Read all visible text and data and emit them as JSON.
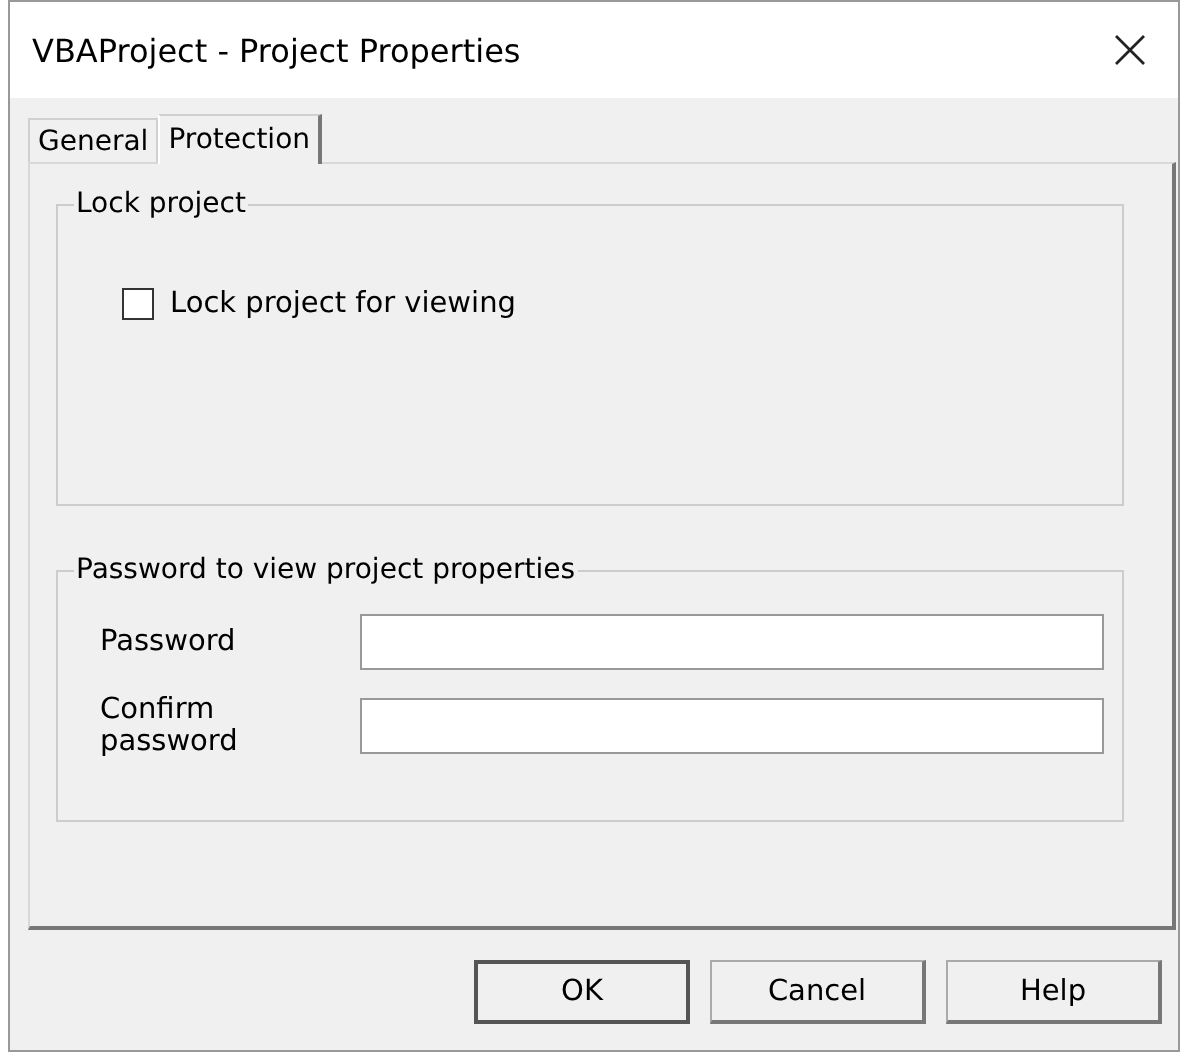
{
  "window": {
    "title": "VBAProject - Project Properties"
  },
  "tabs": [
    {
      "label": "General",
      "selected": false
    },
    {
      "label": "Protection",
      "selected": true
    }
  ],
  "lock_group": {
    "title": "Lock project",
    "checkbox": {
      "label": "Lock project for viewing",
      "checked": false
    }
  },
  "password_group": {
    "title": "Password to view project properties",
    "fields": [
      {
        "label": "Password"
      },
      {
        "label": "Confirm password"
      }
    ]
  },
  "buttons": [
    {
      "label": "OK",
      "default": true
    },
    {
      "label": "Cancel",
      "default": false
    },
    {
      "label": "Help",
      "default": false
    }
  ]
}
